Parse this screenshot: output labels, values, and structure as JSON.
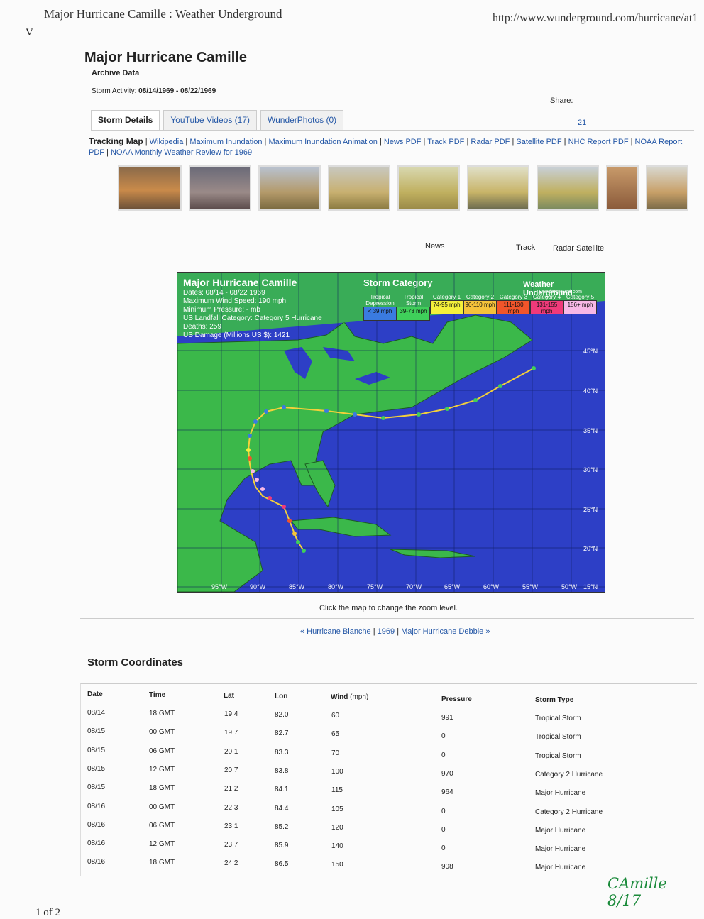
{
  "print_header": {
    "title": "Major Hurricane Camille : Weather Underground",
    "url": "http://www.wunderground.com/hurricane/at1",
    "page_label": "1 of 2",
    "margin_mark": "V"
  },
  "storm": {
    "title": "Major Hurricane Camille",
    "archive_label": "Archive Data",
    "activity_label": "Storm Activity:",
    "activity_dates": "08/14/1969 - 08/22/1969",
    "share_label": "Share:",
    "share_count": "21"
  },
  "tabs": [
    "Storm Details",
    "YouTube Videos (17)",
    "WunderPhotos (0)"
  ],
  "links": {
    "lead": "Tracking Map",
    "items": [
      "Wikipedia",
      "Maximum Inundation",
      "Maximum Inundation Animation",
      "News PDF",
      "Track PDF",
      "Radar PDF",
      "Satellite PDF",
      "NHC Report PDF",
      "NOAA Report PDF",
      "NOAA Monthly Weather Review for 1969"
    ]
  },
  "map_nav": [
    "News",
    "Track",
    "Radar",
    "Satellite"
  ],
  "map": {
    "title": "Major Hurricane Camille",
    "info": [
      "Dates: 08/14 - 08/22 1969",
      "Maximum Wind Speed: 190 mph",
      "Minimum Pressure: - mb",
      "US Landfall Category: Category 5 Hurricane",
      "Deaths: 259",
      "US Damage (Millions US $): 1421"
    ],
    "category_title": "Storm Category",
    "brand": "Weather Underground",
    "brand_sub": "wunderground.com",
    "legend": [
      {
        "name": "Tropical Depression",
        "range": "< 39 mph",
        "color": "#3a7be0"
      },
      {
        "name": "Tropical Storm",
        "range": "39-73 mph",
        "color": "#3fcf5a"
      },
      {
        "name": "Category 1",
        "range": "74-95 mph",
        "color": "#f4f03a"
      },
      {
        "name": "Category 2",
        "range": "96-110 mph",
        "color": "#f5c23a"
      },
      {
        "name": "Category 3",
        "range": "111-130 mph",
        "color": "#f2552a"
      },
      {
        "name": "Category 4",
        "range": "131-155 mph",
        "color": "#f03a7a"
      },
      {
        "name": "Category 5",
        "range": "156+ mph",
        "color": "#f7b8e6"
      }
    ],
    "lat_labels": [
      "45°N",
      "40°N",
      "35°N",
      "30°N",
      "25°N",
      "20°N",
      "15°N"
    ],
    "lon_labels": [
      "95°W",
      "90°W",
      "85°W",
      "80°W",
      "75°W",
      "70°W",
      "65°W",
      "60°W",
      "55°W",
      "50°W"
    ],
    "click_note": "Click the map to change the zoom level."
  },
  "nav": {
    "prev": "« Hurricane Blanche",
    "year": "1969",
    "next": "Major Hurricane Debbie »"
  },
  "coords": {
    "heading": "Storm Coordinates",
    "headers": [
      "Date",
      "Time",
      "Lat",
      "Lon",
      "Wind",
      "(mph)",
      "Pressure",
      "Storm Type"
    ],
    "rows": [
      [
        "08/14",
        "18 GMT",
        "19.4",
        "82.0",
        "60",
        "991",
        "Tropical Storm"
      ],
      [
        "08/15",
        "00 GMT",
        "19.7",
        "82.7",
        "65",
        "0",
        "Tropical Storm"
      ],
      [
        "08/15",
        "06 GMT",
        "20.1",
        "83.3",
        "70",
        "0",
        "Tropical Storm"
      ],
      [
        "08/15",
        "12 GMT",
        "20.7",
        "83.8",
        "100",
        "970",
        "Category 2 Hurricane"
      ],
      [
        "08/15",
        "18 GMT",
        "21.2",
        "84.1",
        "115",
        "964",
        "Major Hurricane"
      ],
      [
        "08/16",
        "00 GMT",
        "22.3",
        "84.4",
        "105",
        "0",
        "Category 2 Hurricane"
      ],
      [
        "08/16",
        "06 GMT",
        "23.1",
        "85.2",
        "120",
        "0",
        "Major Hurricane"
      ],
      [
        "08/16",
        "12 GMT",
        "23.7",
        "85.9",
        "140",
        "0",
        "Major Hurricane"
      ],
      [
        "08/16",
        "18 GMT",
        "24.2",
        "86.5",
        "150",
        "908",
        "Major Hurricane"
      ]
    ]
  },
  "annotation": "CAmille 8/17"
}
